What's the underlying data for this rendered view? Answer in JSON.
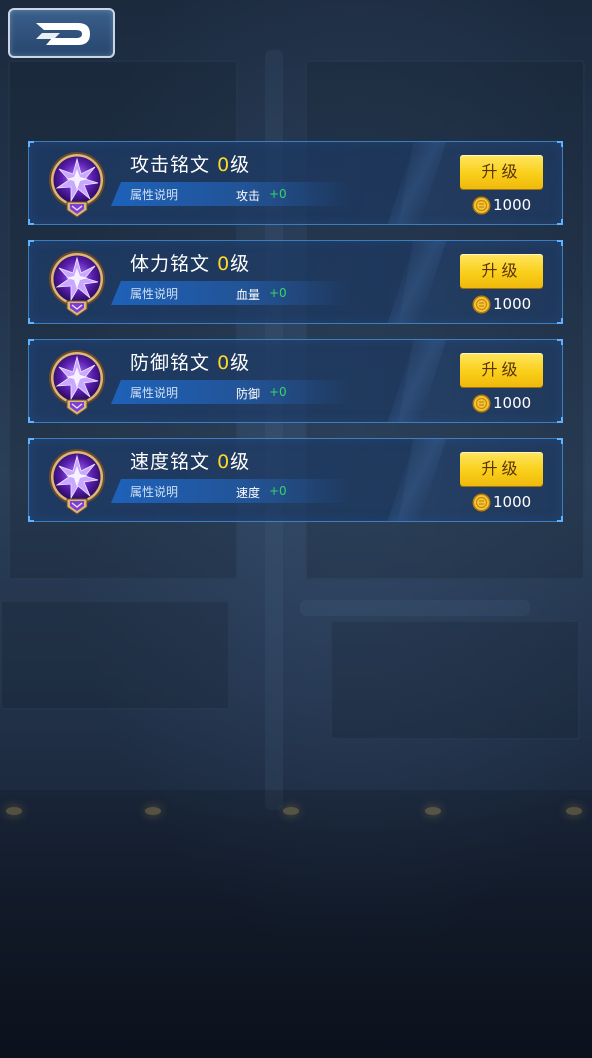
{
  "back_button": {
    "icon": "back-arrow-icon"
  },
  "runes": [
    {
      "name": "攻击铭文",
      "level": "0",
      "level_suffix": "级",
      "attr_label": "属性说明",
      "attr_name": "攻击",
      "attr_value": "+0",
      "upgrade_label": "升级",
      "cost": "1000",
      "icon": "purple-star-rune-icon"
    },
    {
      "name": "体力铭文",
      "level": "0",
      "level_suffix": "级",
      "attr_label": "属性说明",
      "attr_name": "血量",
      "attr_value": "+0",
      "upgrade_label": "升级",
      "cost": "1000",
      "icon": "purple-star-rune-icon"
    },
    {
      "name": "防御铭文",
      "level": "0",
      "level_suffix": "级",
      "attr_label": "属性说明",
      "attr_name": "防御",
      "attr_value": "+0",
      "upgrade_label": "升级",
      "cost": "1000",
      "icon": "purple-star-rune-icon"
    },
    {
      "name": "速度铭文",
      "level": "0",
      "level_suffix": "级",
      "attr_label": "属性说明",
      "attr_name": "速度",
      "attr_value": "+0",
      "upgrade_label": "升级",
      "cost": "1000",
      "icon": "purple-star-rune-icon"
    }
  ],
  "colors": {
    "level": "#ffd928",
    "attr_value": "#36d46b",
    "button": "#f9cf1a",
    "frame": "#4696dc"
  }
}
